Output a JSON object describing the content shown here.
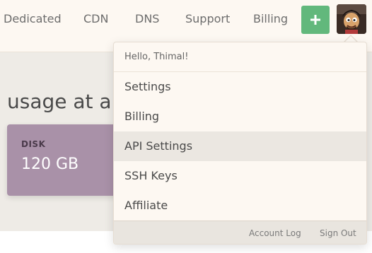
{
  "nav": {
    "links": [
      "Dedicated",
      "CDN",
      "DNS",
      "Support",
      "Billing"
    ],
    "add_button_label": "+",
    "colors": {
      "add_button": "#62b87c",
      "background": "#fdf8f2"
    }
  },
  "main": {
    "usage_title": "usage at a glance",
    "disk_card": {
      "label": "DISK",
      "value": "120 GB",
      "color": "#a991a8"
    }
  },
  "user_menu": {
    "greeting": "Hello, Thimal!",
    "items": [
      {
        "label": "Settings",
        "active": false
      },
      {
        "label": "Billing",
        "active": false
      },
      {
        "label": "API Settings",
        "active": true
      },
      {
        "label": "SSH Keys",
        "active": false
      },
      {
        "label": "Affiliate",
        "active": false
      }
    ],
    "footer": {
      "account_log": "Account Log",
      "sign_out": "Sign Out"
    }
  },
  "icons": [
    "plus-icon",
    "avatar-image"
  ]
}
